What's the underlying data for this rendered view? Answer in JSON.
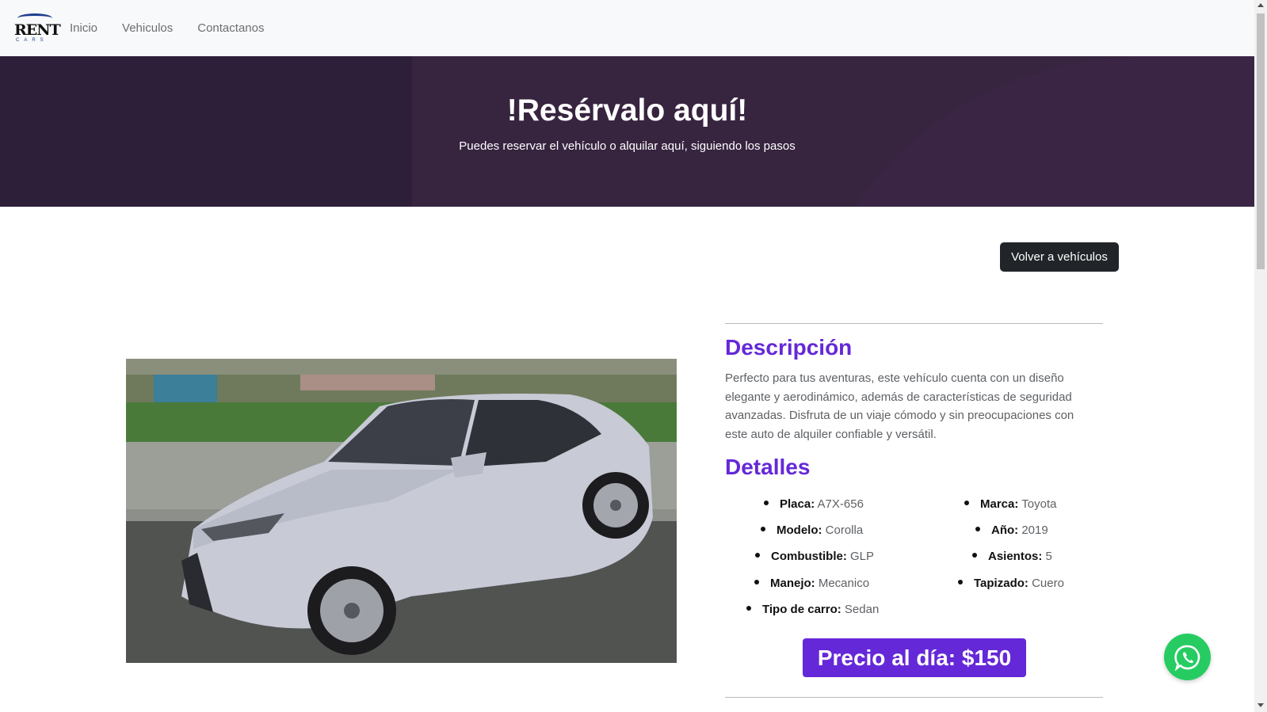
{
  "nav": {
    "logo_text": "RENT",
    "logo_sub": "CARS",
    "links": [
      "Inicio",
      "Vehiculos",
      "Contactanos"
    ]
  },
  "hero": {
    "title": "!Resérvalo aquí!",
    "subtitle": "Puedes reservar el vehículo o alquilar aquí, siguiendo los pasos"
  },
  "back_button": "Volver a vehículos",
  "description": {
    "title": "Descripción",
    "text": "Perfecto para tus aventuras, este vehículo cuenta con un diseño elegante y aerodinámico, además de características de seguridad avanzadas. Disfruta de un viaje cómodo y sin preocupaciones con este auto de alquiler confiable y versátil."
  },
  "details": {
    "title": "Detalles",
    "items": [
      {
        "label": "Placa:",
        "value": "A7X-656"
      },
      {
        "label": "Marca:",
        "value": "Toyota"
      },
      {
        "label": "Modelo:",
        "value": "Corolla"
      },
      {
        "label": "Año:",
        "value": "2019"
      },
      {
        "label": "Combustible:",
        "value": "GLP"
      },
      {
        "label": "Asientos:",
        "value": "5"
      },
      {
        "label": "Manejo:",
        "value": "Mecanico"
      },
      {
        "label": "Tapizado:",
        "value": "Cuero"
      },
      {
        "label": "Tipo de carro:",
        "value": "Sedan"
      }
    ]
  },
  "price": "Precio al día: $150",
  "colors": {
    "accent": "#6528d8",
    "hero_bg": "#2d1f39",
    "whatsapp": "#26cc62",
    "dark_button": "#212529"
  },
  "icons": {
    "whatsapp": "whatsapp-icon"
  }
}
